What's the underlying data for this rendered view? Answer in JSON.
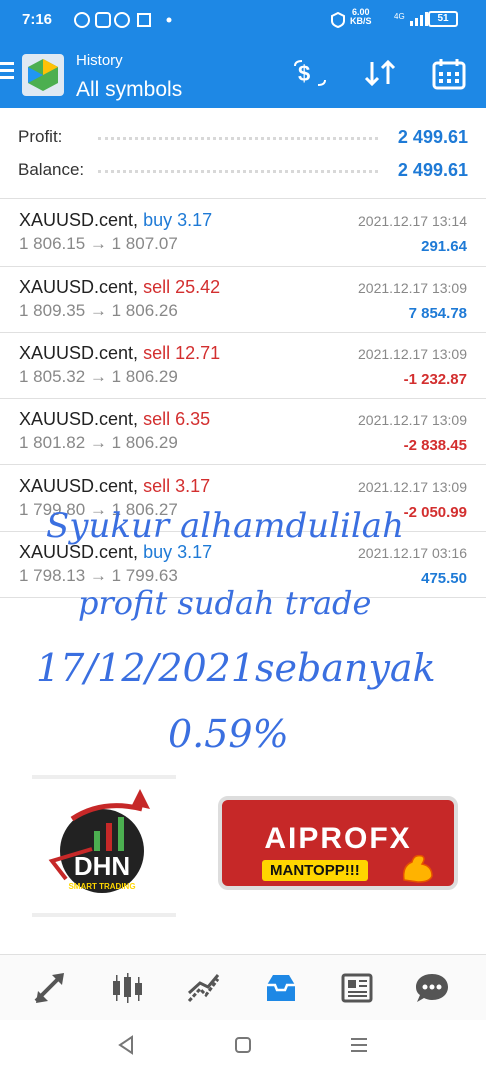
{
  "status_bar": {
    "time": "7:16",
    "speed_value": "6.00",
    "speed_unit": "KB/S",
    "network_type": "4G",
    "battery": "51"
  },
  "app_bar": {
    "title": "History",
    "subtitle": "All symbols"
  },
  "summary": {
    "profit_label": "Profit:",
    "profit_value": "2 499.61",
    "balance_label": "Balance:",
    "balance_value": "2 499.61"
  },
  "trades": [
    {
      "symbol": "XAUUSD.cent,",
      "side": "buy 3.17",
      "prices": "1 806.15 → 1 807.07",
      "date": "2021.12.17 13:14",
      "profit": "291.64"
    },
    {
      "symbol": "XAUUSD.cent,",
      "side": "sell 25.42",
      "prices": "1 809.35 → 1 806.26",
      "date": "2021.12.17 13:09",
      "profit": "7 854.78"
    },
    {
      "symbol": "XAUUSD.cent,",
      "side": "sell 12.71",
      "prices": "1 805.32 → 1 806.29",
      "date": "2021.12.17 13:09",
      "profit": "-1 232.87"
    },
    {
      "symbol": "XAUUSD.cent,",
      "side": "sell 6.35",
      "prices": "1 801.82 → 1 806.29",
      "date": "2021.12.17 13:09",
      "profit": "-2 838.45"
    },
    {
      "symbol": "XAUUSD.cent,",
      "side": "sell 3.17",
      "prices": "1 799.80 → 1 806.27",
      "date": "2021.12.17 13:09",
      "profit": "-2 050.99"
    },
    {
      "symbol": "XAUUSD.cent,",
      "side": "buy 3.17",
      "prices": "1 798.13 → 1 799.63",
      "date": "2021.12.17 03:16",
      "profit": "475.50"
    }
  ],
  "overlay": {
    "line1": "Syukur alhamdulilah",
    "line2": "profit sudah trade",
    "line3": "17/12/2021sebanyak",
    "line4": "0.59%"
  },
  "logos": {
    "dhn_name": "DHN",
    "dhn_tagline": "SMART TRADING",
    "aiprofx_name": "AIPROFX",
    "aiprofx_slogan": "MANTOPP!!!"
  },
  "colors": {
    "primary": "#1e88e5",
    "profit_positive": "#1e7ad6",
    "loss_negative": "#d32f2f",
    "overlay_text": "#3a6fe0"
  },
  "bottom_nav": [
    {
      "name": "quotes-icon"
    },
    {
      "name": "chart-icon"
    },
    {
      "name": "trade-icon"
    },
    {
      "name": "history-icon",
      "active": true
    },
    {
      "name": "news-icon"
    },
    {
      "name": "messages-icon"
    }
  ]
}
